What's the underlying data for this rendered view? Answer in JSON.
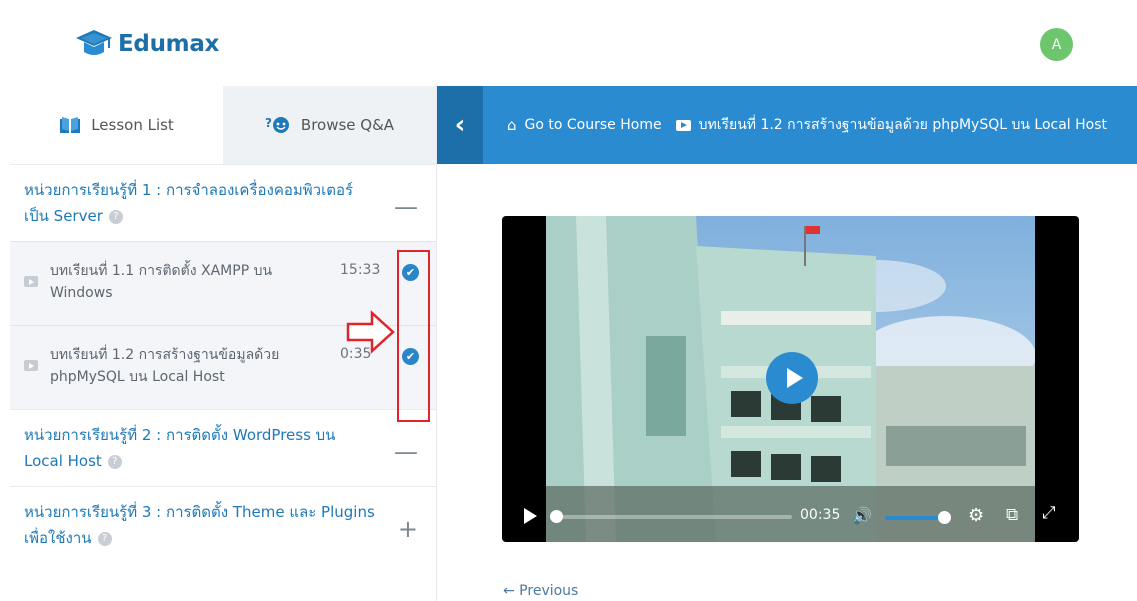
{
  "header": {
    "logo_text": "Edumax",
    "avatar_initial": "A"
  },
  "tabs": [
    {
      "label": "Lesson List",
      "icon": "book-icon",
      "active": true
    },
    {
      "label": "Browse Q&A",
      "icon": "qa-icon",
      "active": false
    }
  ],
  "sections": [
    {
      "title": "หน่วยการเรียนรู้ที่ 1 : การจำลองเครื่องคอมพิวเตอร์เป็น Server",
      "toggle": "—",
      "lessons": [
        {
          "title": "บทเรียนที่ 1.1 การติดตั้ง XAMPP บน Windows",
          "duration": "15:33",
          "completed": true
        },
        {
          "title": "บทเรียนที่ 1.2 การสร้างฐานข้อมูลด้วย phpMySQL บน Local Host",
          "duration": "0:35",
          "completed": true
        }
      ]
    },
    {
      "title": "หน่วยการเรียนรู้ที่ 2 : การติดตั้ง WordPress บน Local Host",
      "toggle": "—"
    },
    {
      "title": "หน่วยการเรียนรู้ที่ 3 : การติดตั้ง Theme และ Plugins เพื่อใช้งาน",
      "toggle": "+"
    }
  ],
  "topbar": {
    "home_label": "Go to Course Home",
    "current_lesson": "บทเรียนที่ 1.2 การสร้างฐานข้อมูลด้วย phpMySQL บน Local Host"
  },
  "player": {
    "time": "00:35",
    "progress": 0.0,
    "volume": 1.0
  },
  "nav": {
    "previous": "← Previous"
  },
  "colors": {
    "accent": "#2a8bd0",
    "accent_dark": "#1d6fa9",
    "section_title": "#1e79b8",
    "annotation": "#e0242b",
    "avatar": "#6dc56d"
  }
}
